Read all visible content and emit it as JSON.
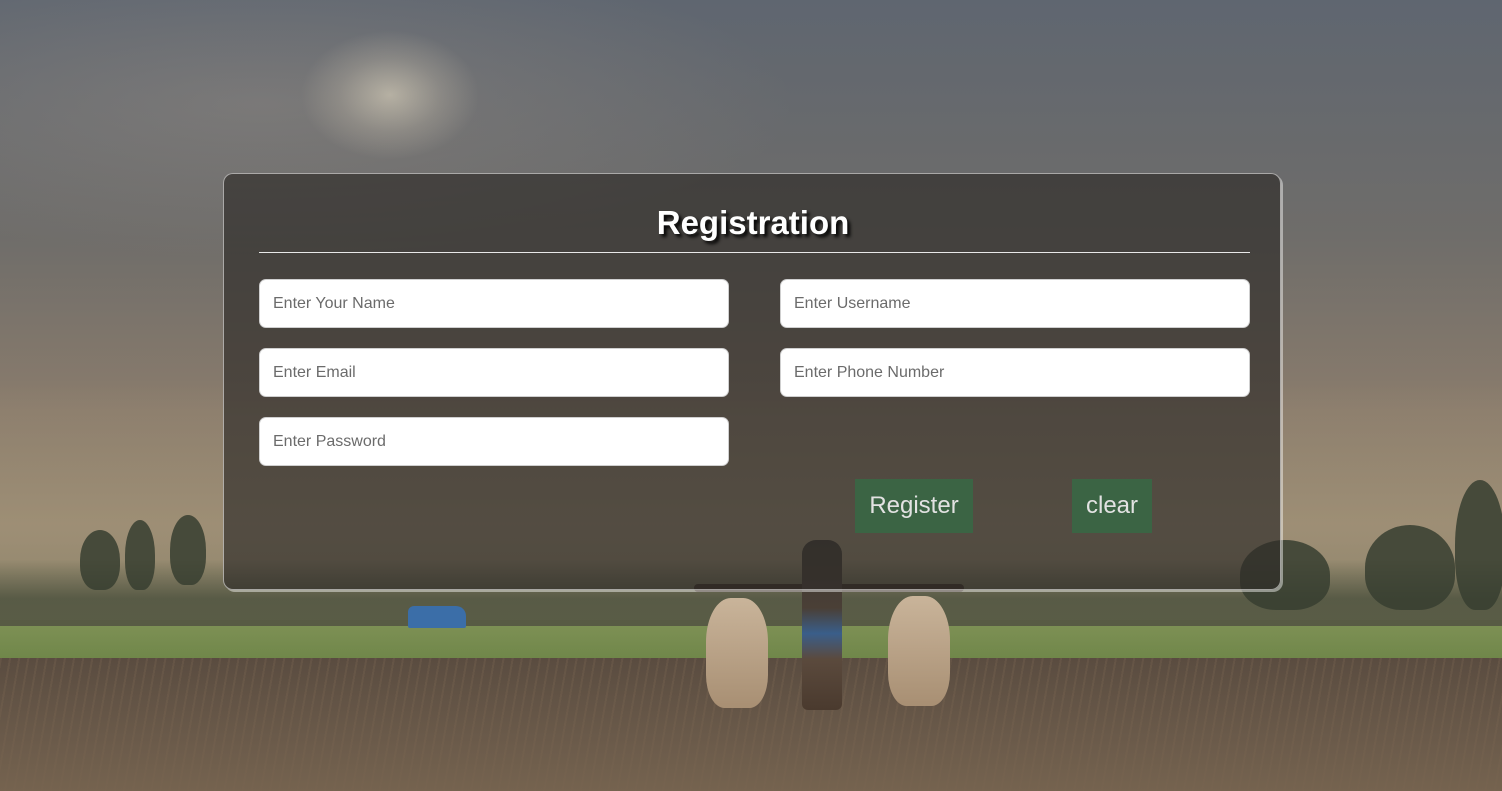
{
  "form": {
    "title": "Registration",
    "fields": {
      "name": {
        "placeholder": "Enter Your Name",
        "value": ""
      },
      "username": {
        "placeholder": "Enter Username",
        "value": ""
      },
      "email": {
        "placeholder": "Enter Email",
        "value": ""
      },
      "phone": {
        "placeholder": "Enter Phone Number",
        "value": ""
      },
      "password": {
        "placeholder": "Enter Password",
        "value": ""
      }
    },
    "buttons": {
      "register": "Register",
      "clear": "clear"
    }
  },
  "colors": {
    "button_bg": "#3b6444",
    "card_bg": "rgba(45,42,40,0.66)"
  }
}
